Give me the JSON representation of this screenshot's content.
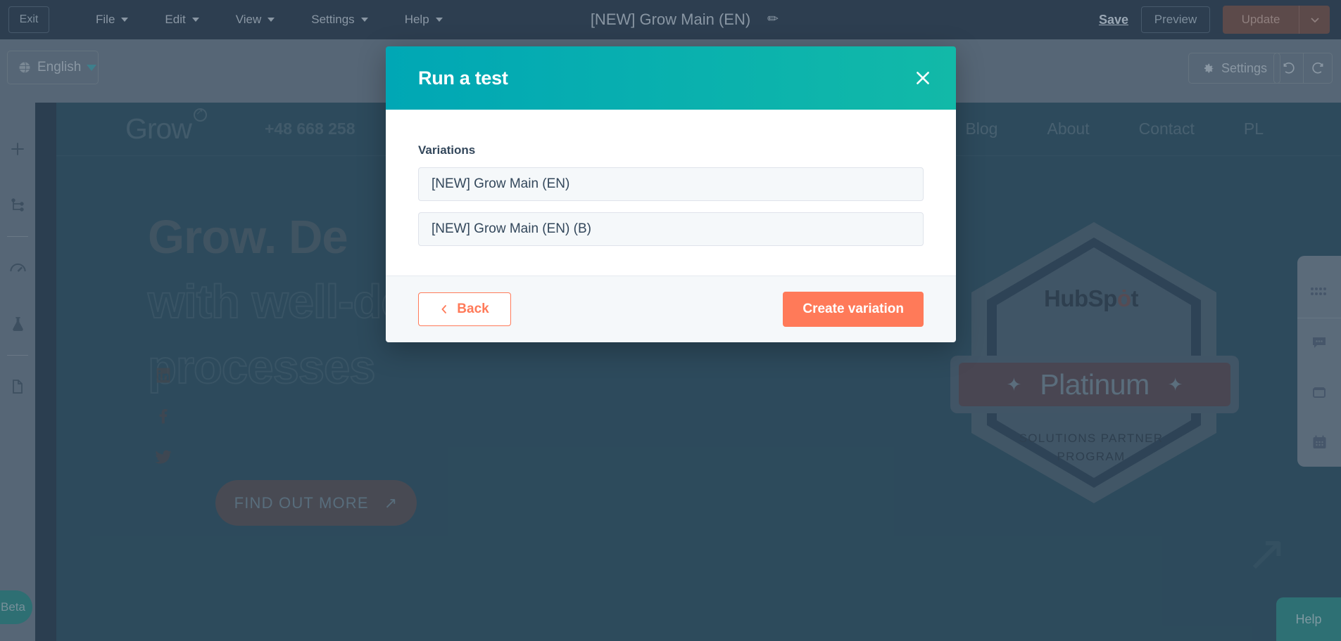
{
  "topbar": {
    "exit_label": "Exit",
    "menus": [
      {
        "label": "File",
        "icon": "chevron-down-icon"
      },
      {
        "label": "Edit",
        "icon": "chevron-down-icon"
      },
      {
        "label": "View",
        "icon": "chevron-down-icon"
      },
      {
        "label": "Settings",
        "icon": "chevron-down-icon"
      },
      {
        "label": "Help",
        "icon": "chevron-down-icon"
      }
    ],
    "document_title": "[NEW] Grow Main (EN)",
    "edit_title_icon": "pencil-icon",
    "save_label": "Save",
    "preview_label": "Preview",
    "update_label": "Update",
    "update_dropdown_icon": "chevron-down-icon",
    "bar_color": "#2d3e50"
  },
  "toolbar": {
    "language_label": "English",
    "language_icon": "globe-icon",
    "language_caret_icon": "caret-down-icon",
    "settings_label": "Settings",
    "settings_icon": "gear-icon",
    "undo_icon": "undo-icon",
    "redo_icon": "redo-icon",
    "bar_color": "#566676"
  },
  "left_rail": {
    "items": [
      {
        "name": "add-block",
        "icon": "plus-icon"
      },
      {
        "name": "structure",
        "icon": "sitemap-icon"
      },
      {
        "name": "performance",
        "icon": "gauge-icon"
      },
      {
        "name": "experiments",
        "icon": "flask-icon"
      },
      {
        "name": "pages",
        "icon": "document-icon"
      }
    ],
    "beta_label": "Beta",
    "beta_color": "#2e6f73"
  },
  "right_rail": {
    "items": [
      {
        "name": "modules",
        "icon": "grid-dots-icon"
      },
      {
        "name": "chat",
        "icon": "chat-bubble-icon"
      },
      {
        "name": "window",
        "icon": "window-icon"
      },
      {
        "name": "calendar",
        "icon": "calendar-icon"
      }
    ],
    "help_label": "Help",
    "help_color": "#2e7074"
  },
  "modal": {
    "title": "Run a test",
    "close_icon": "close-icon",
    "header_gradient_from": "#00a7b5",
    "header_gradient_to": "#12b9a8",
    "variations_label": "Variations",
    "variations": [
      "[NEW] Grow Main (EN)",
      "[NEW] Grow Main (EN) (B)"
    ],
    "back_label": "Back",
    "back_icon": "chevron-left-icon",
    "create_label": "Create variation",
    "accent_color": "#ff7a59"
  },
  "preview": {
    "logo_text": "Grow",
    "logo_mark_icon": "registered-arrow-icon",
    "phone": "+48 668 258",
    "nav": [
      "Blog",
      "About",
      "Contact",
      "PL"
    ],
    "hero_line1": "Grow. De",
    "hero_line2": "with well-designed",
    "hero_line3": "processes",
    "cta_label": "FIND OUT MORE",
    "cta_icon": "arrow-up-right-icon",
    "social": [
      {
        "name": "linkedin",
        "icon": "linkedin-icon"
      },
      {
        "name": "facebook",
        "icon": "facebook-icon"
      },
      {
        "name": "twitter",
        "icon": "twitter-icon"
      }
    ],
    "badge": {
      "brand": "HubSp",
      "brand_tail": "t",
      "tier": "Platinum",
      "subtitle_line1": "SOLUTIONS PARTNER",
      "subtitle_line2": "PROGRAM",
      "star_icon": "sparkle-icon"
    },
    "background_color": "#2f5a6b"
  }
}
